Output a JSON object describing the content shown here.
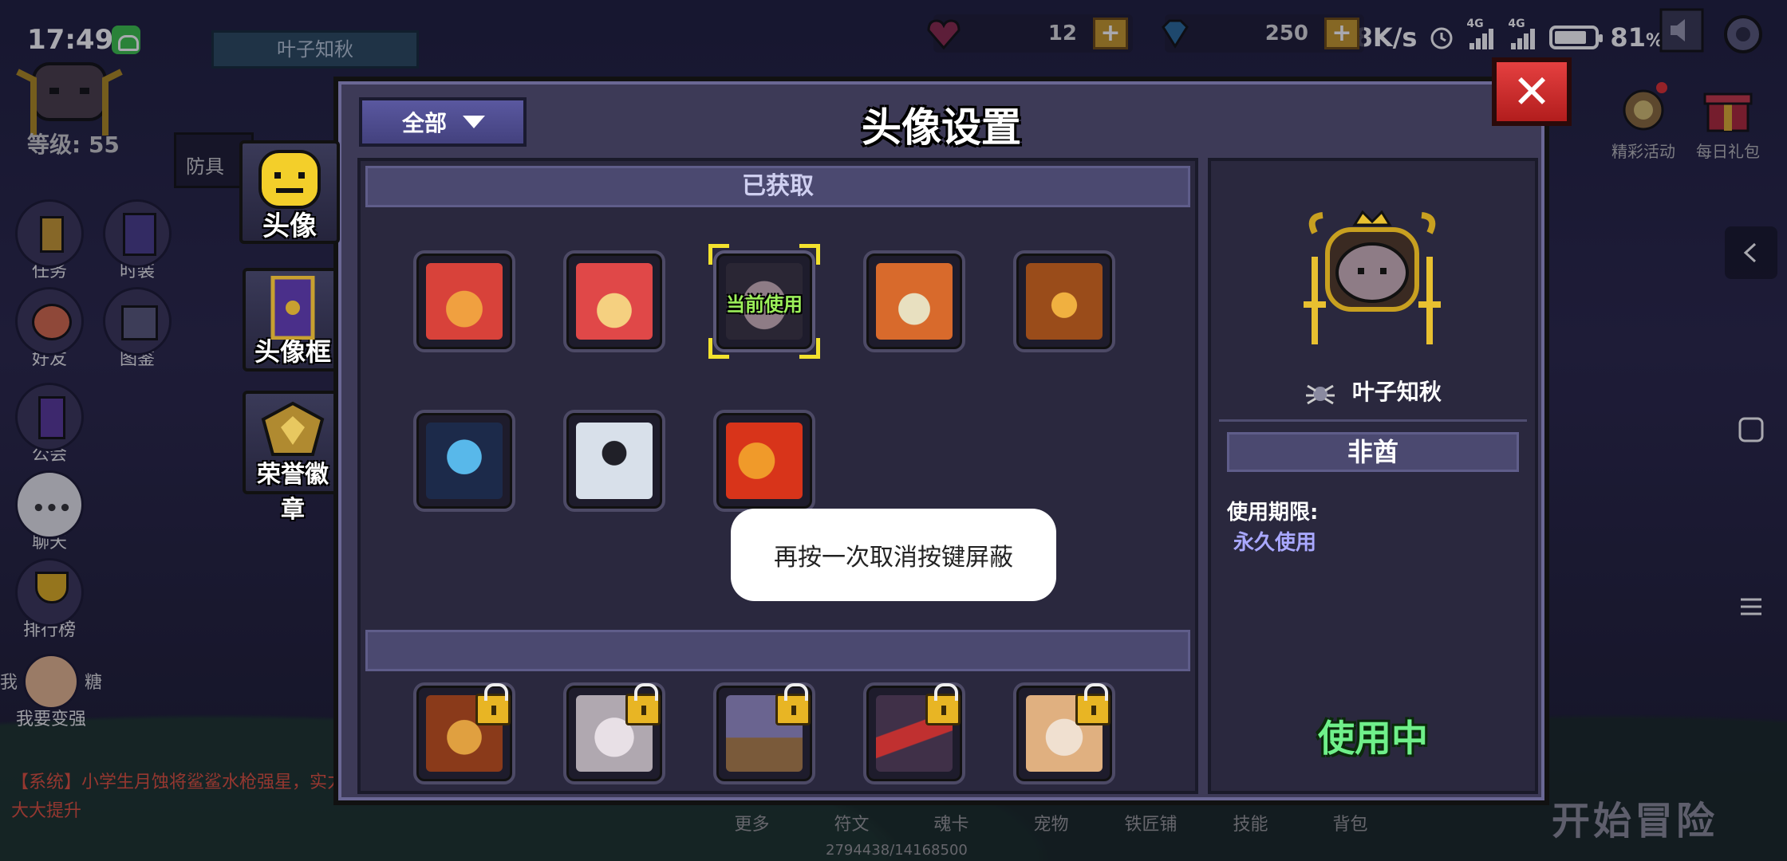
{
  "status_bar": {
    "time": "17:49",
    "network_speed": "1.8K/s",
    "signal1_tag": "4G",
    "signal2_tag": "4G",
    "battery_percent": "81",
    "battery_unit": "%"
  },
  "resources": {
    "gems": "12",
    "diamonds": "250"
  },
  "player": {
    "name": "叶子知秋",
    "level_label": "等级: 55"
  },
  "left_menu": [
    {
      "label": "任务",
      "icon": "quest-icon"
    },
    {
      "label": "时装",
      "icon": "costume-icon"
    },
    {
      "label": "好友",
      "icon": "friends-icon"
    },
    {
      "label": "图鉴",
      "icon": "codex-icon"
    },
    {
      "label": "公会",
      "icon": "guild-icon"
    },
    {
      "label": "聊天",
      "icon": "chat-icon"
    },
    {
      "label": "排行榜",
      "icon": "trophy-icon"
    },
    {
      "label": "我要变强",
      "icon": "powerup-icon"
    }
  ],
  "left_partial": {
    "armor_text": "防具",
    "rune_left": "我",
    "rune_right": "糖"
  },
  "top_right_icons": [
    {
      "label": "精彩活动",
      "icon": "event-icon"
    },
    {
      "label": "每日礼包",
      "icon": "gift-icon"
    }
  ],
  "system_message": "【系统】小学生月蚀将鲨鲨水枪强星，实力大大提升",
  "bottom_nav": [
    "更多",
    "符文",
    "魂卡",
    "宠物",
    "铁匠铺",
    "技能",
    "背包"
  ],
  "exp_text": "2794438/14168500",
  "start_button": "开始冒险",
  "side_tabs": [
    {
      "label": "头像",
      "active": true
    },
    {
      "label": "头像框",
      "active": false
    },
    {
      "label": "荣誉徽章",
      "active": false
    }
  ],
  "dialog": {
    "title": "头像设置",
    "filter_label": "全部",
    "close_label": "✕",
    "obtained_header": "已获取",
    "current_use_label": "当前使用",
    "obtained_avatars": [
      {
        "name": "red-knight-avatar",
        "c1": "#d8423a",
        "c2": "#f0a040"
      },
      {
        "name": "red-helmet-girl-avatar",
        "c1": "#e04848",
        "c2": "#f5d080"
      },
      {
        "name": "current-slime-avatar",
        "c1": "#5a4c5c",
        "c2": "#8e7c86"
      },
      {
        "name": "red-panda-avatar",
        "c1": "#d86a2c",
        "c2": "#e8e0c0"
      },
      {
        "name": "pumpkin-avatar",
        "c1": "#9a4c1a",
        "c2": "#f0b040"
      },
      {
        "name": "blue-spirit-avatar",
        "c1": "#1c4a8a",
        "c2": "#58b8ea"
      },
      {
        "name": "skeleton-avatar",
        "c1": "#d8e0ea",
        "c2": "#202028"
      },
      {
        "name": "fire-dragon-avatar",
        "c1": "#d8341a",
        "c2": "#f09a2a"
      }
    ],
    "locked_avatars": [
      {
        "name": "fire-bird-avatar",
        "c1": "#8a3a1a",
        "c2": "#e0a040"
      },
      {
        "name": "white-beast-avatar",
        "c1": "#b0a8b0",
        "c2": "#e8e0e6"
      },
      {
        "name": "tree-avatar",
        "c1": "#6a6490",
        "c2": "#5a8a3a"
      },
      {
        "name": "red-chevron-avatar",
        "c1": "#403048",
        "c2": "#c03030"
      },
      {
        "name": "fox-girl-avatar",
        "c1": "#e0b080",
        "c2": "#f0e0d0"
      }
    ],
    "detail": {
      "player_name": "叶子知秋",
      "title": "非酋",
      "limit_label": "使用期限:",
      "limit_value": "永久使用",
      "status": "使用中"
    }
  },
  "toast": "再按一次取消按键屏蔽"
}
